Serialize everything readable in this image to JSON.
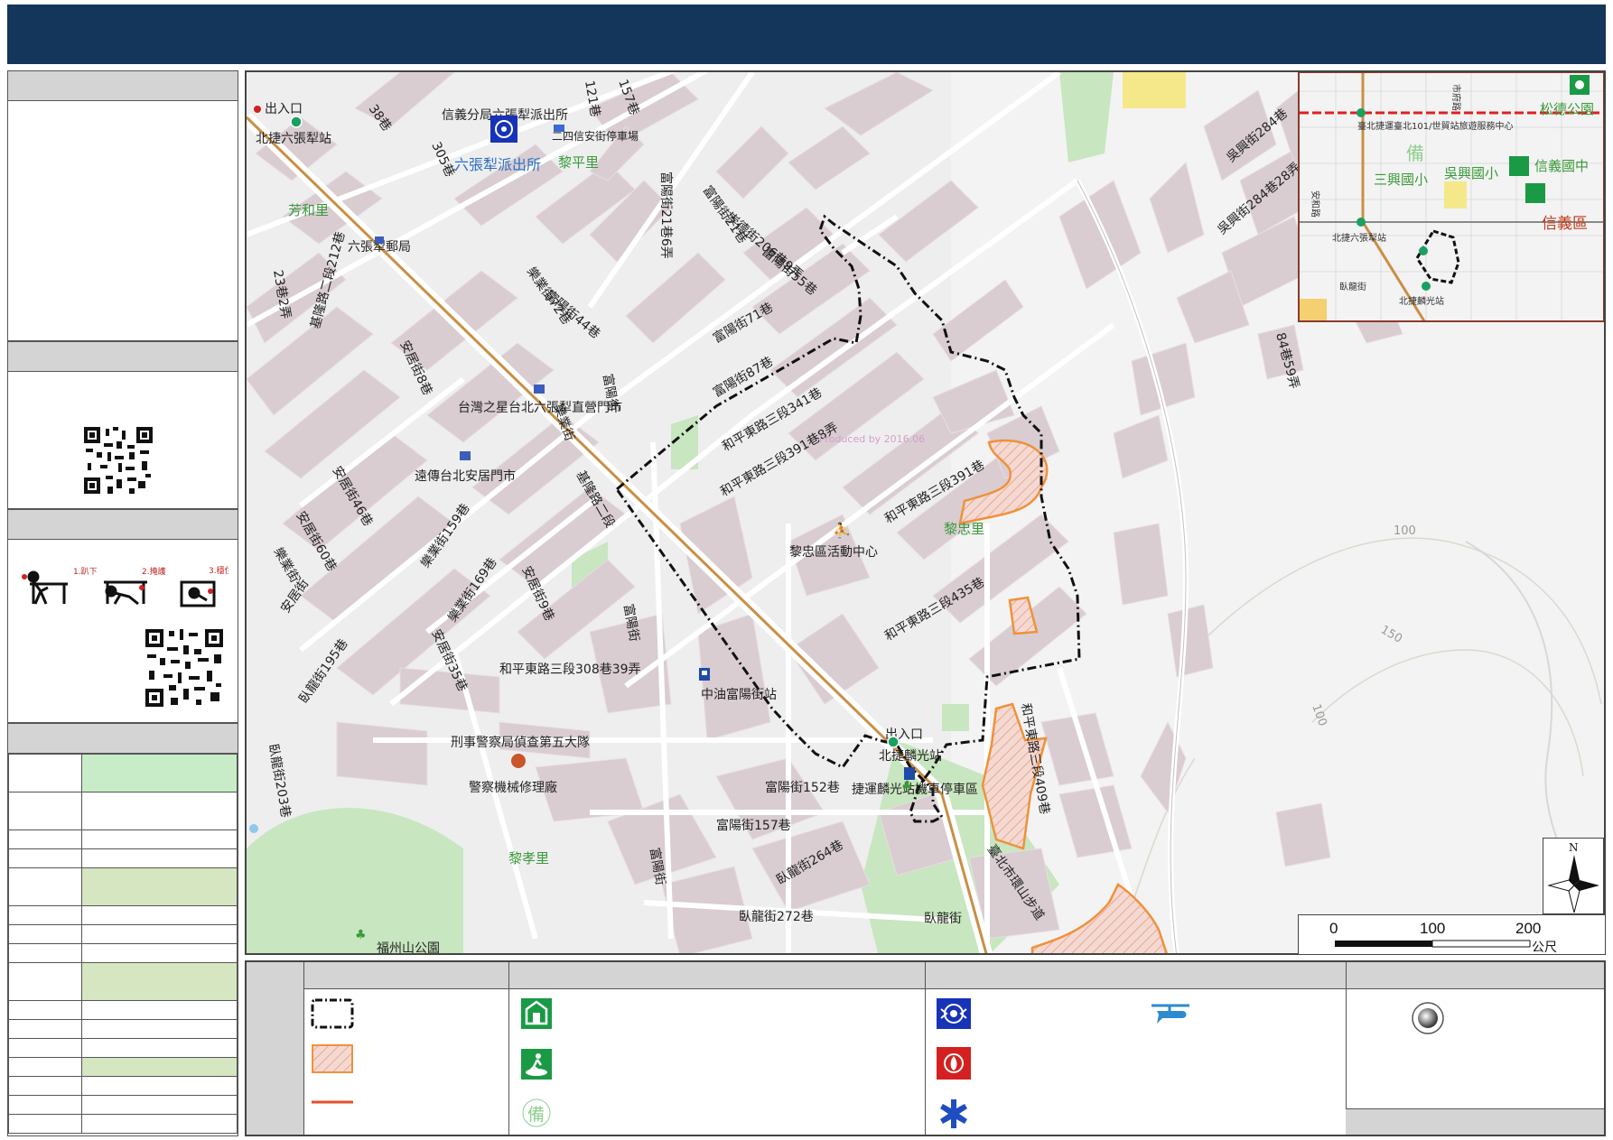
{
  "map": {
    "labels": {
      "top_left_exit": "出入口",
      "station_liuzhangli": "北捷六張犁站",
      "police_station_name": "信義分局六張犁派出所",
      "police_station_label": "六張犁派出所",
      "parking_24": "二四信安街停車場",
      "village_liping": "黎平里",
      "village_fanghe": "芳和里",
      "post_office": "六張犁郵局",
      "village_lizhong": "黎忠里",
      "village_lixiao": "黎孝里",
      "community_center": "黎忠區活動中心",
      "store_taiwanstar": "台灣之星台北六張犁直營門市",
      "store_fareastone": "遠傳台北安居門市",
      "gas_station": "中油富陽街站",
      "station_linguang": "北捷麟光站",
      "exit_linguang": "出入口",
      "parking_linguang": "捷運麟光站機車停車區",
      "cib_fifth": "刑事警察局偵查第五大隊",
      "police_repair": "警察機械修理廠",
      "park_bottom": "福州山公園",
      "road_heping_391": "和平東路三段391巷",
      "road_heping_391_8": "和平東路三段391巷8弄",
      "road_heping_341": "和平東路三段341巷",
      "road_heping_435": "和平東路三段435巷",
      "road_heping_308": "和平東路三段308巷39弄",
      "road_heping_409": "和平東路三段409巷",
      "road_fuyang": "富陽街",
      "road_fuyang_44": "富陽街44巷",
      "road_fuyang_21": "富陽街21巷",
      "road_fuyang_21_6": "富陽街21巷6弄",
      "road_fuyang_55": "富陽街55巷",
      "road_fuyang_71": "富陽街71巷",
      "road_fuyang_87": "富陽街87巷",
      "road_fuyang_152": "富陽街152巷",
      "road_fuyang_157": "富陽街157巷",
      "road_wolong": "臥龍街",
      "road_wolong_195": "臥龍街195巷",
      "road_wolong_203": "臥龍街203巷",
      "road_wolong_264": "臥龍街264巷",
      "road_wolong_272": "臥龍街272巷",
      "road_anju": "安居街",
      "road_anju_35": "安居街35巷",
      "road_anju_8": "安居街8巷",
      "road_anju_9": "安居街9巷",
      "road_anju_46": "安居街46巷",
      "road_anju_60": "安居街60巷",
      "road_leye": "樂業街",
      "road_leye_159": "樂業街159巷",
      "road_leye_169": "樂業街169巷",
      "road_leye_72": "樂業街72巷",
      "road_chongde_206": "崇德街206巷9弄",
      "road_wuxing_284": "吳興街284巷",
      "road_wuxing_284_28": "吳興街284巷28弄",
      "road_keelung": "基隆路二段",
      "road_keelung_2": "基隆路二段212巷",
      "road_taipei_ring": "臺北市環山步道",
      "road_121": "121巷",
      "road_157": "157巷",
      "road_305": "305巷",
      "road_38": "38巷",
      "road_23_2": "23巷2弄",
      "road_84_59": "84巷59弄",
      "contour_100a": "100",
      "contour_150": "150",
      "contour_100b": "100",
      "watermark": "Produced by 2016.06"
    }
  },
  "inset": {
    "labels": {
      "songde_park": "松德公園",
      "mrt_line": "臺北捷運臺北101/世貿站旅遊服務中心",
      "city_hall": "市府路",
      "sanxing": "三興國小",
      "wuxing": "吳興國小",
      "xinyi_jh": "信義國中",
      "xinyi_district": "信義區",
      "anhe": "安和路",
      "liuzhangli": "北捷六張犁站",
      "wolong": "臥龍街",
      "linguang": "北捷麟光站",
      "prepare_char": "備"
    }
  },
  "scale": {
    "ticks": [
      "0",
      "100",
      "200"
    ],
    "unit": "公尺"
  },
  "north": {
    "letter": "N"
  },
  "sidebar": {
    "drop_cover_labels": [
      "1.趴下",
      "2.掩護",
      "3.穩住"
    ]
  },
  "legend": {
    "prepare_char": "備"
  },
  "colors": {
    "title_bar": "#13365a",
    "evac_route": "#e0522a",
    "hazard_orange": "#f0913a",
    "table_green": "#c8ecc8",
    "table_olive": "#d5e6c0"
  }
}
